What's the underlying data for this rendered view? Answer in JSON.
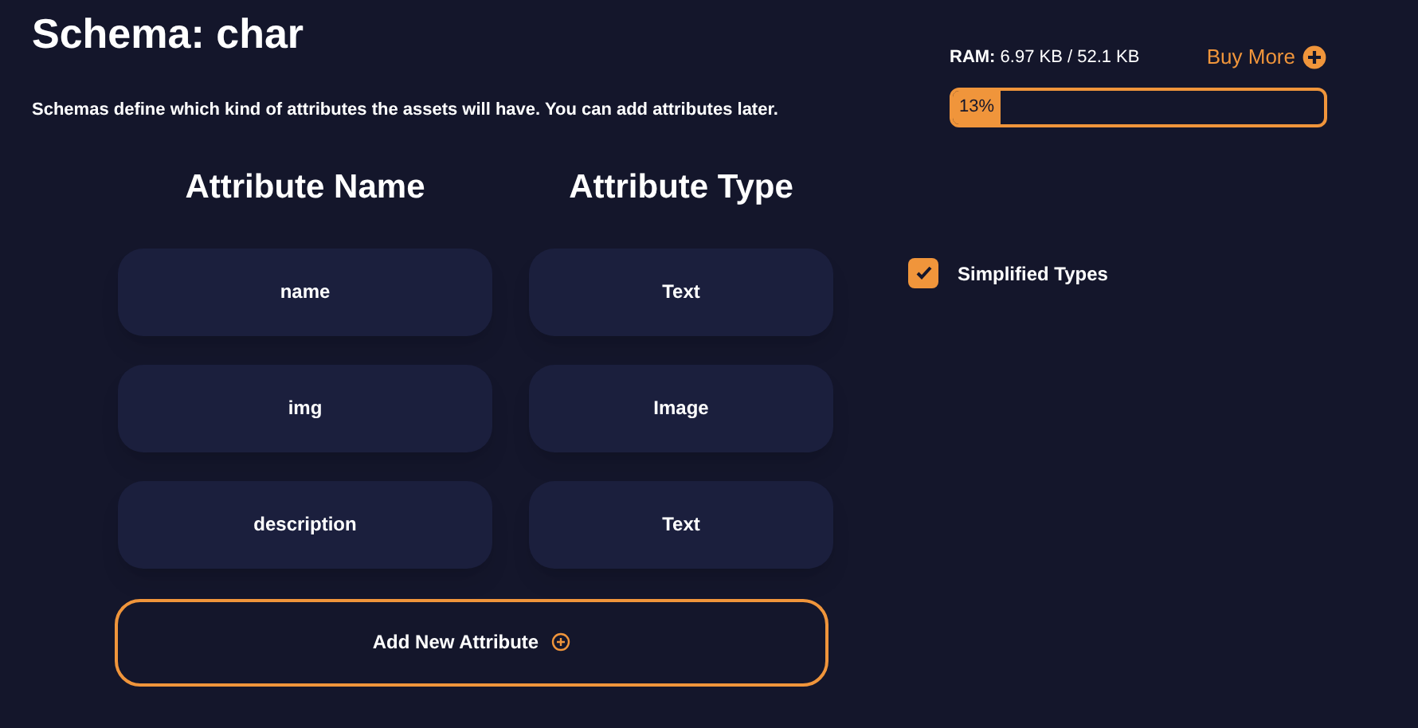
{
  "title": "Schema: char",
  "description": "Schemas define which kind of attributes the assets will have. You can add attributes later.",
  "ram": {
    "label": "RAM:",
    "reading": "6.97 KB / 52.1 KB",
    "level": 0.13,
    "percent": "13%",
    "buy_more": "Buy More"
  },
  "table": {
    "columns": [
      "Attribute Name",
      "Attribute Type"
    ],
    "rows": [
      {
        "name": "name",
        "type": "Text"
      },
      {
        "name": "img",
        "type": "Image"
      },
      {
        "name": "description",
        "type": "Text"
      }
    ]
  },
  "add_button": "Add New Attribute",
  "simplified_types": {
    "label": "Simplified Types",
    "checked": true
  }
}
